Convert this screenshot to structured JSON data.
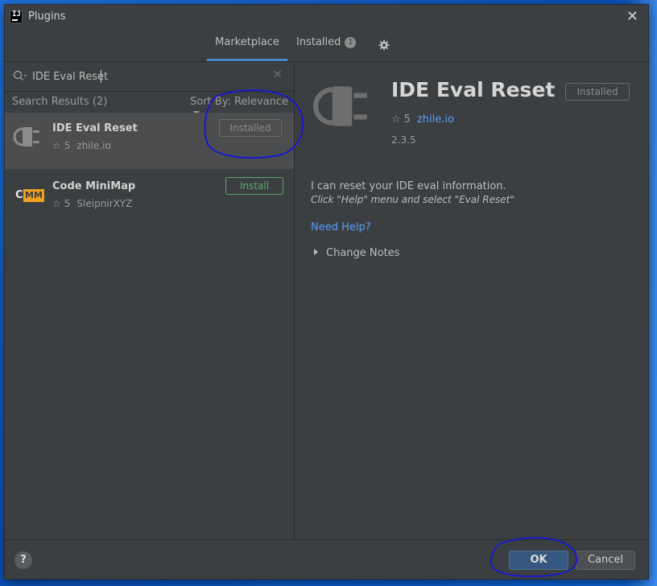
{
  "window": {
    "title": "Plugins",
    "close_glyph": "✕"
  },
  "tabs": [
    {
      "label": "Marketplace",
      "active": true
    },
    {
      "label": "Installed",
      "badge": "1",
      "active": false
    }
  ],
  "settings_icon": "gear-icon",
  "search": {
    "value": "IDE Eval Reset",
    "clear_glyph": "✕"
  },
  "results": {
    "count_label": "Search Results (2)",
    "sort_label": "Sort By: Relevance"
  },
  "plugins": [
    {
      "name": "IDE Eval Reset",
      "rating": "5",
      "vendor": "zhile.io",
      "action": "Installed",
      "selected": true,
      "icon": "plug-icon"
    },
    {
      "name": "Code MiniMap",
      "rating": "5",
      "vendor": "SleipnirXYZ",
      "action": "Install",
      "selected": false,
      "icon_text_c": "C",
      "icon_text_mm": "MM"
    }
  ],
  "detail": {
    "name": "IDE Eval Reset",
    "status_button": "Installed",
    "rating": "5",
    "vendor": "zhile.io",
    "version": "2.3.5",
    "description_line1": "I can reset your IDE eval information.",
    "description_line2": "Click \"Help\" menu and select \"Eval Reset\"",
    "help_link": "Need Help?",
    "change_notes": "Change Notes"
  },
  "footer": {
    "help_glyph": "?",
    "ok_label": "OK",
    "cancel_label": "Cancel"
  },
  "colors": {
    "accent": "#4a88c7",
    "link": "#589df6",
    "install_green": "#59a869",
    "annotation": "#1a1acc"
  }
}
